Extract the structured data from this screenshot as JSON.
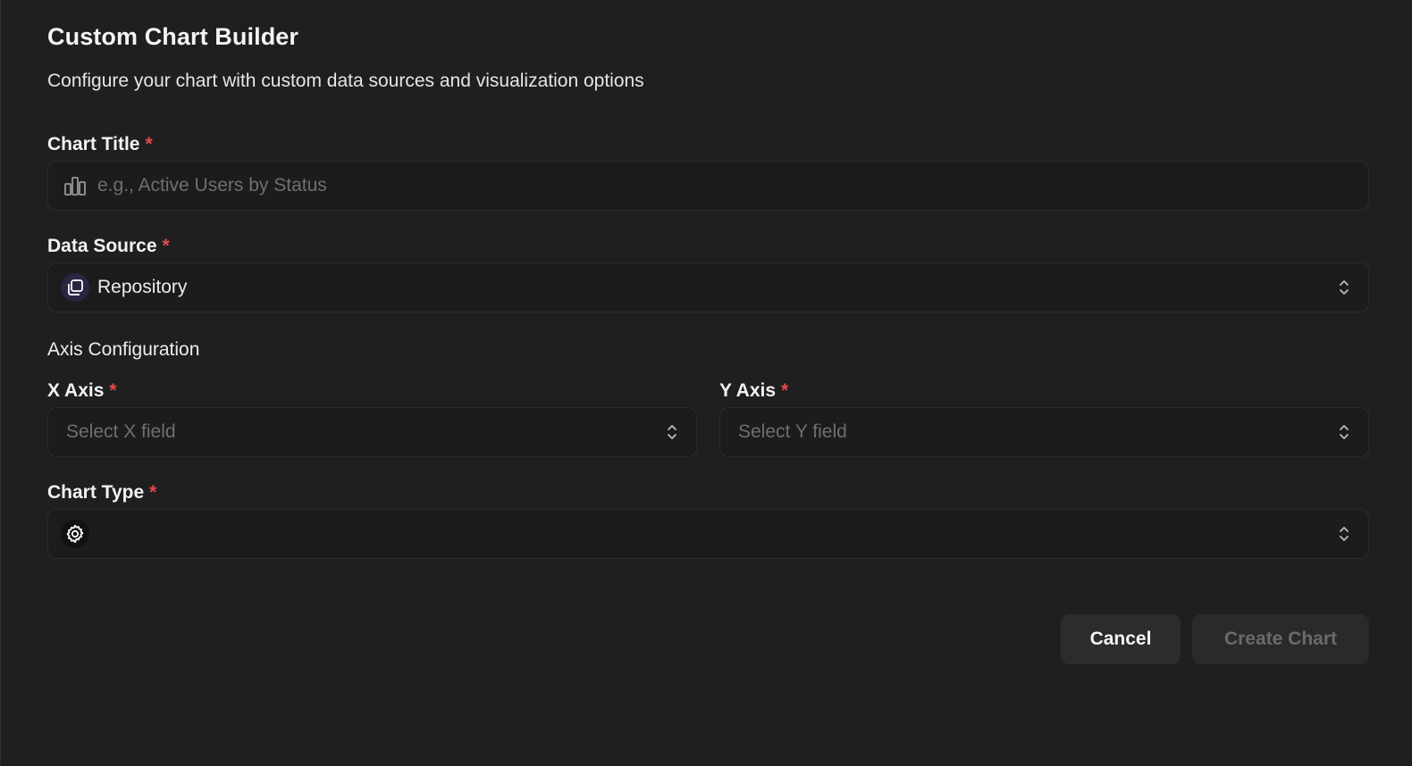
{
  "dialog": {
    "title": "Custom Chart Builder",
    "subtitle": "Configure your chart with custom data sources and visualization options"
  },
  "chart_title": {
    "label": "Chart Title",
    "required_mark": "*",
    "placeholder": "e.g., Active Users by Status",
    "icon": "bar-chart-icon"
  },
  "data_source": {
    "label": "Data Source",
    "required_mark": "*",
    "value": "Repository",
    "icon": "repository-icon"
  },
  "axis_config": {
    "heading": "Axis Configuration",
    "x_axis": {
      "label": "X Axis",
      "required_mark": "*",
      "placeholder": "Select X field"
    },
    "y_axis": {
      "label": "Y Axis",
      "required_mark": "*",
      "placeholder": "Select Y field"
    }
  },
  "chart_type": {
    "label": "Chart Type",
    "required_mark": "*",
    "value": "",
    "icon": "gear-icon"
  },
  "actions": {
    "cancel_label": "Cancel",
    "create_label": "Create Chart"
  },
  "colors": {
    "background": "#1f1f1f",
    "required": "#e5484d",
    "repo_badge": "#2c2542"
  }
}
